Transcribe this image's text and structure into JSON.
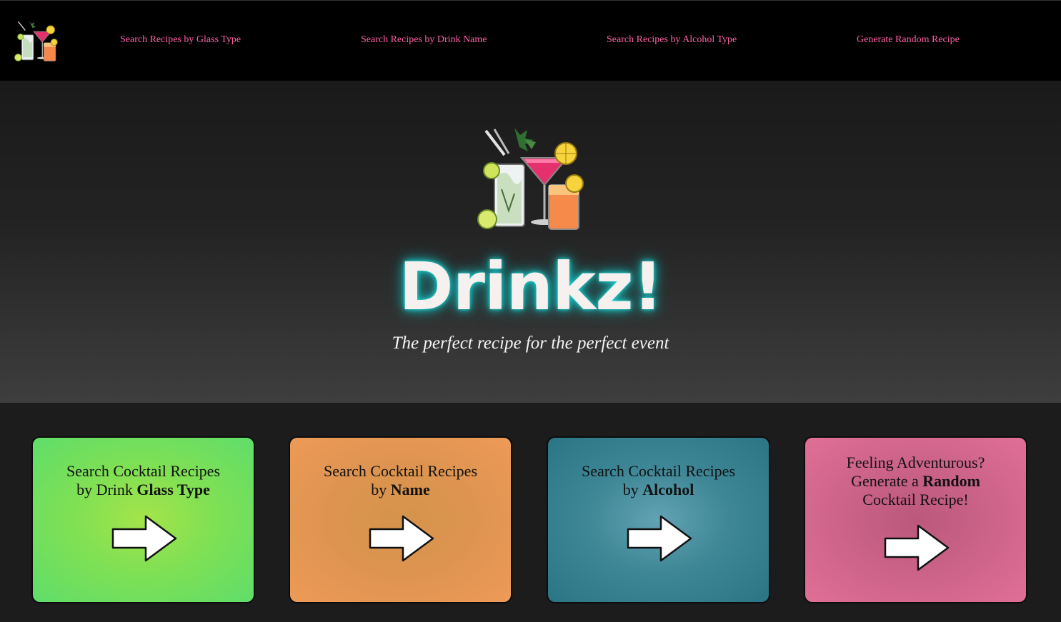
{
  "nav": {
    "logo_alt": "cocktail-logo",
    "links": [
      "Search Recipes by Glass Type",
      "Search Recipes by Drink Name",
      "Search Recipes by Alcohol Type",
      "Generate Random Recipe"
    ],
    "link_color": "#ff5fa8"
  },
  "hero": {
    "title": "Drinkz!",
    "subtitle": "The perfect recipe for the perfect event",
    "glow_color": "#1fd6d6"
  },
  "cards": [
    {
      "line1": "Search Cocktail Recipes",
      "line2_pre": "by Drink ",
      "line2_bold": "Glass Type",
      "color": "#80e054"
    },
    {
      "line1": "Search Cocktail Recipes",
      "line2_pre": "by ",
      "line2_bold": "Name",
      "color": "#dd9450"
    },
    {
      "line1": "Search Cocktail Recipes",
      "line2_pre": "by ",
      "line2_bold": "Alcohol",
      "color": "#3f8796"
    },
    {
      "line1": "Feeling Adventurous?",
      "line2_pre": "Generate a ",
      "line2_bold": "Random",
      "line3": "Cocktail Recipe!",
      "color": "#cb6288"
    }
  ],
  "icons": {
    "card_arrow": "right-arrow-icon",
    "logo": "cocktail-glasses-icon"
  }
}
